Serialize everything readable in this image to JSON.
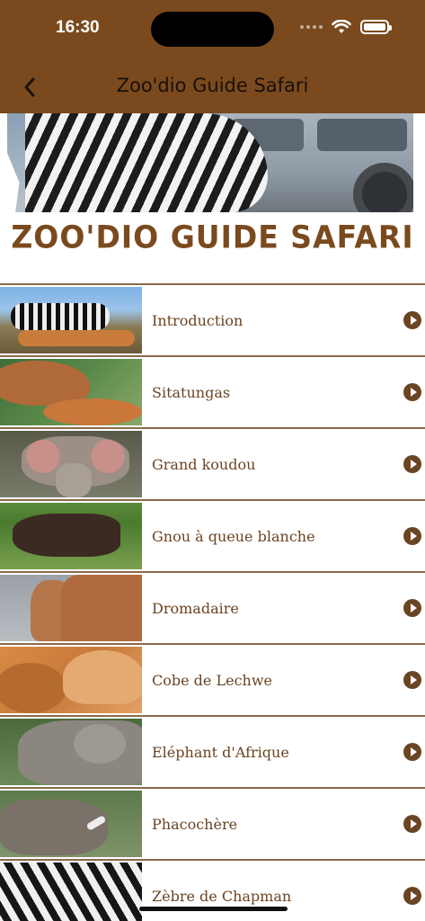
{
  "status_bar": {
    "time": "16:30"
  },
  "nav": {
    "title": "Zoo'dio Guide Safari"
  },
  "banner": {
    "brand_title": "ZOO'DIO GUIDE SAFARI"
  },
  "list": {
    "items": [
      {
        "label": "Introduction",
        "icon": "zebras-thumbnail"
      },
      {
        "label": "Sitatungas",
        "icon": "sitatunga-thumbnail"
      },
      {
        "label": "Grand koudou",
        "icon": "kudu-thumbnail"
      },
      {
        "label": "Gnou à queue blanche",
        "icon": "wildebeest-thumbnail"
      },
      {
        "label": "Dromadaire",
        "icon": "camel-thumbnail"
      },
      {
        "label": "Cobe de Lechwe",
        "icon": "lechwe-thumbnail"
      },
      {
        "label": " Eléphant d'Afrique",
        "icon": "elephant-thumbnail"
      },
      {
        "label": "Phacochère",
        "icon": "warthog-thumbnail"
      },
      {
        "label": "Zèbre de Chapman",
        "icon": "zebra-thumbnail"
      }
    ]
  },
  "colors": {
    "header_bg": "#7a4a1e",
    "accent_brown": "#6b4422"
  }
}
